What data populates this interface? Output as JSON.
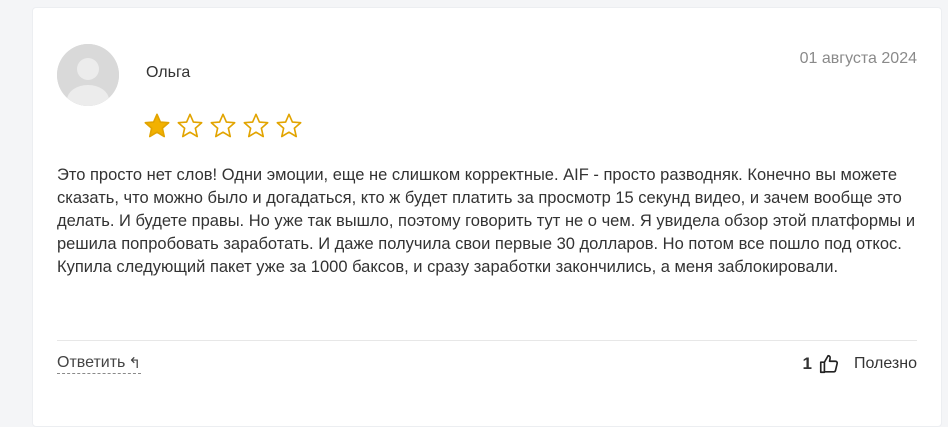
{
  "review": {
    "author": "Ольга",
    "date": "01 августа 2024",
    "rating": 1,
    "max_rating": 5,
    "text": "Это просто нет слов! Одни эмоции, еще не слишком корректные. AIF - просто разводняк. Конечно вы можете сказать, что можно было и догадаться, кто ж будет платить за просмотр 15 секунд видео, и зачем вообще это делать. И будете правы. Но уже так вышло, поэтому говорить тут не о чем. Я увидела обзор этой платформы и решила попробовать заработать. И даже получила свои первые 30 долларов. Но потом все пошло под откос. Купила следующий пакет уже за 1000 баксов, и сразу заработки закончились, а меня заблокировали."
  },
  "actions": {
    "reply_label": "Ответить",
    "reply_icon": "reply-arrow-icon",
    "likes_count": "1",
    "like_icon": "thumbs-up-icon",
    "helpful_label": "Полезно"
  },
  "colors": {
    "star_filled": "#f2b100",
    "star_stroke": "#e2a400",
    "avatar_bg": "#d9d9d9",
    "date_text": "#8a8a8a"
  }
}
